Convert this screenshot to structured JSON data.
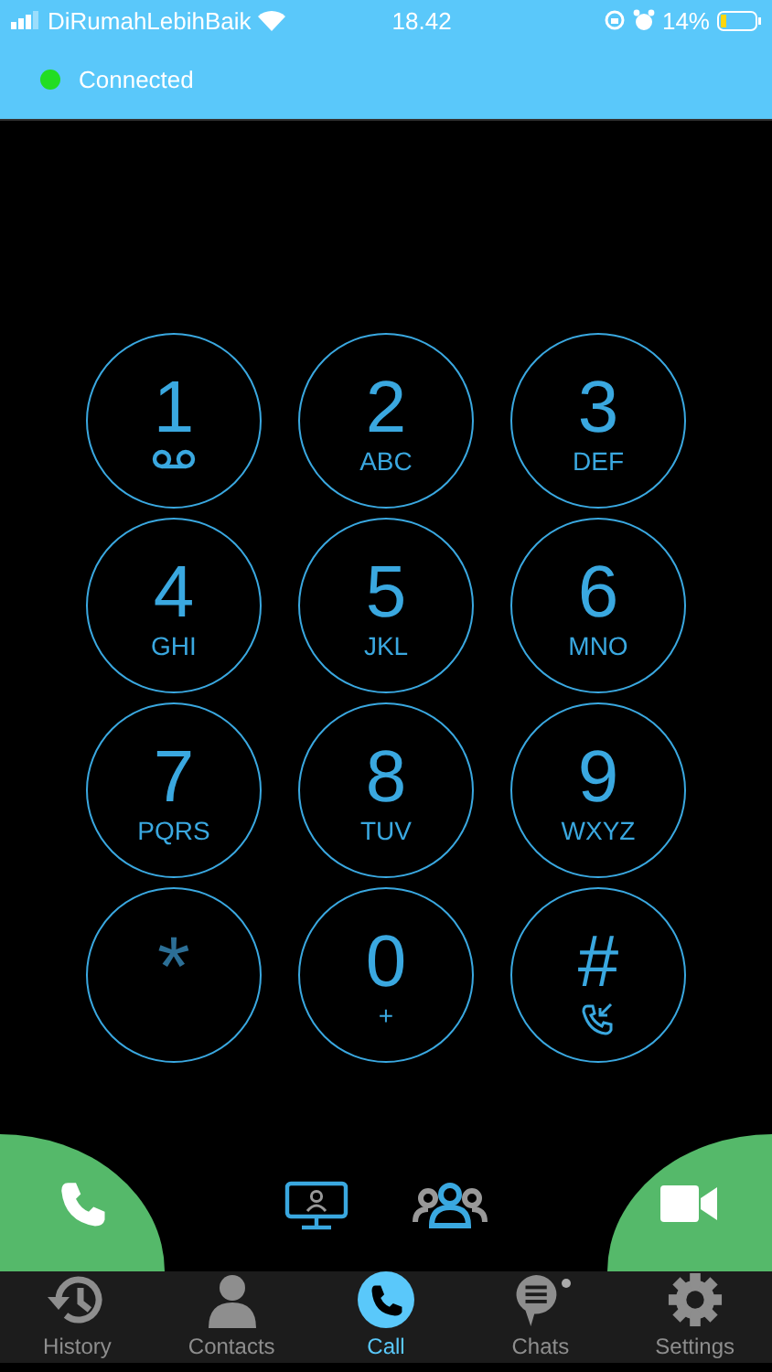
{
  "status_bar": {
    "carrier": "DiRumahLebihBaik",
    "time": "18.42",
    "battery": "14%"
  },
  "connection": {
    "label": "Connected",
    "connected": true
  },
  "keypad": [
    {
      "key": "1",
      "kind": "voicemail"
    },
    {
      "key": "2",
      "letters": "ABC",
      "kind": "digit"
    },
    {
      "key": "3",
      "letters": "DEF",
      "kind": "digit"
    },
    {
      "key": "4",
      "letters": "GHI",
      "kind": "digit"
    },
    {
      "key": "5",
      "letters": "JKL",
      "kind": "digit"
    },
    {
      "key": "6",
      "letters": "MNO",
      "kind": "digit"
    },
    {
      "key": "7",
      "letters": "PQRS",
      "kind": "digit"
    },
    {
      "key": "8",
      "letters": "TUV",
      "kind": "digit"
    },
    {
      "key": "9",
      "letters": "WXYZ",
      "kind": "digit"
    },
    {
      "key": "*",
      "kind": "star"
    },
    {
      "key": "0",
      "letters": "+",
      "kind": "digit"
    },
    {
      "key": "#",
      "kind": "incoming"
    }
  ],
  "tabs": [
    {
      "label": "History",
      "kind": "history",
      "selected": false,
      "badge": false
    },
    {
      "label": "Contacts",
      "kind": "contacts",
      "selected": false,
      "badge": false
    },
    {
      "label": "Call",
      "kind": "call",
      "selected": true,
      "badge": false
    },
    {
      "label": "Chats",
      "kind": "chats",
      "selected": false,
      "badge": true
    },
    {
      "label": "Settings",
      "kind": "settings",
      "selected": false,
      "badge": false
    }
  ]
}
